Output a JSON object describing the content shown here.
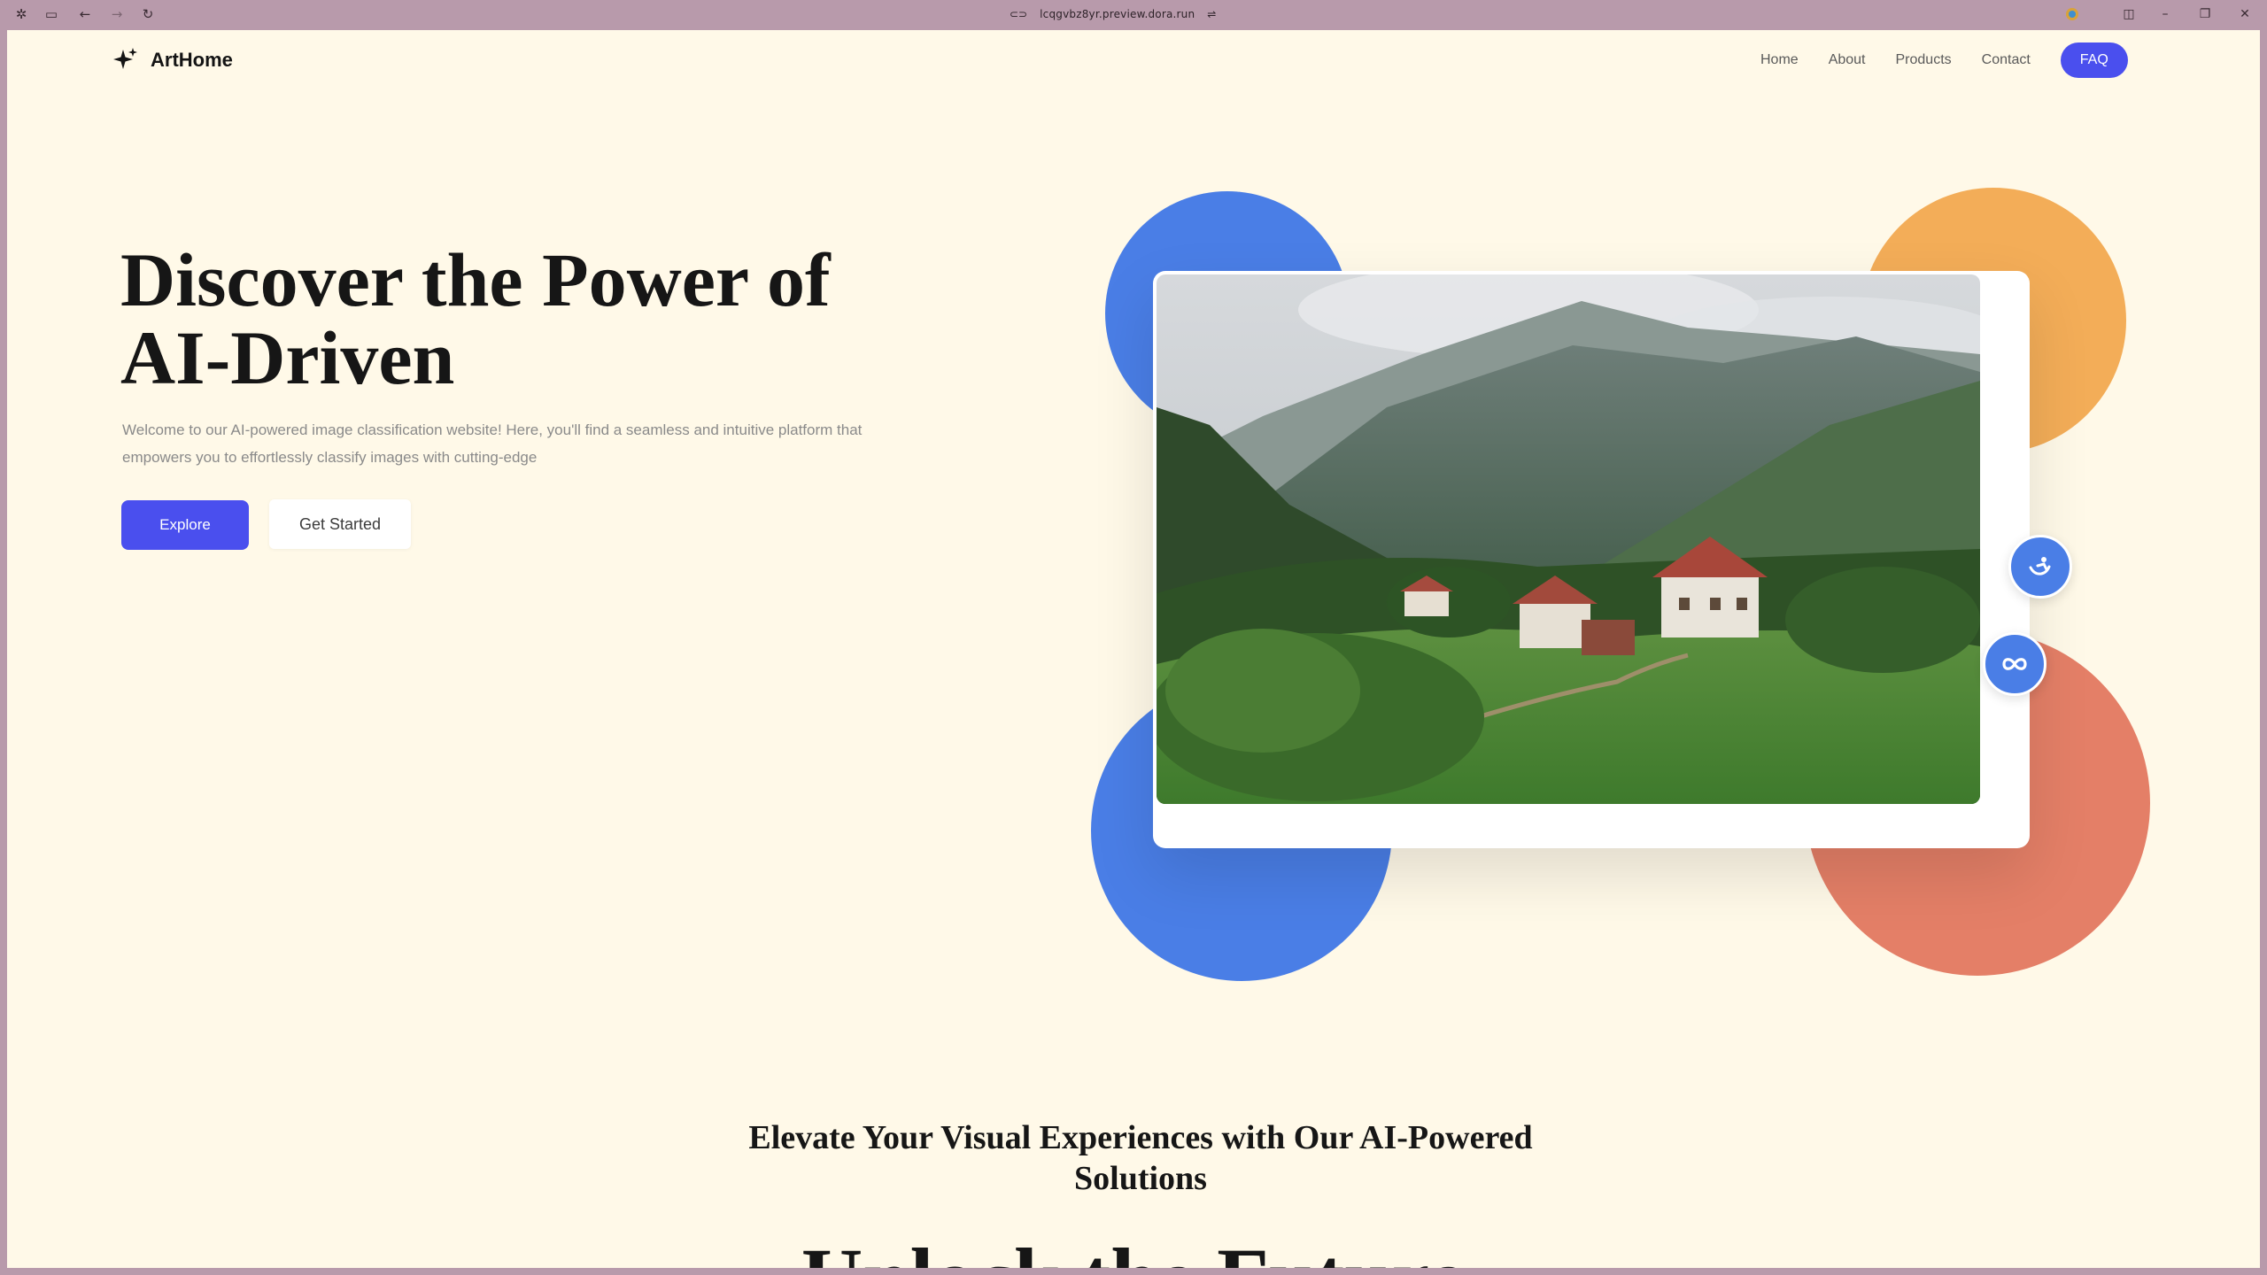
{
  "browser": {
    "url": "lcqgvbz8yr.preview.dora.run"
  },
  "nav": {
    "logo_text": "ArtHome",
    "links": [
      "Home",
      "About",
      "Products",
      "Contact"
    ],
    "faq_label": "FAQ"
  },
  "hero": {
    "title_line1": "Discover the Power of",
    "title_line2": "AI-Driven",
    "description": "Welcome to our AI-powered image classification website! Here, you'll find a seamless and intuitive platform that empowers you to effortlessly classify images with cutting-edge",
    "explore_label": "Explore",
    "get_started_label": "Get Started"
  },
  "section": {
    "title": "Elevate Your Visual Experiences with Our AI-Powered Solutions",
    "big_heading": "Unlock the Future"
  },
  "colors": {
    "primary": "#4a4fee",
    "accent_blue": "#4a7ee6",
    "accent_orange": "#f3ad58",
    "accent_salmon": "#e47f67",
    "background": "#fff9e8"
  },
  "icons": {
    "logo": "sparkle-icon",
    "fab1": "leaf-person-icon",
    "fab2": "infinity-link-icon"
  }
}
